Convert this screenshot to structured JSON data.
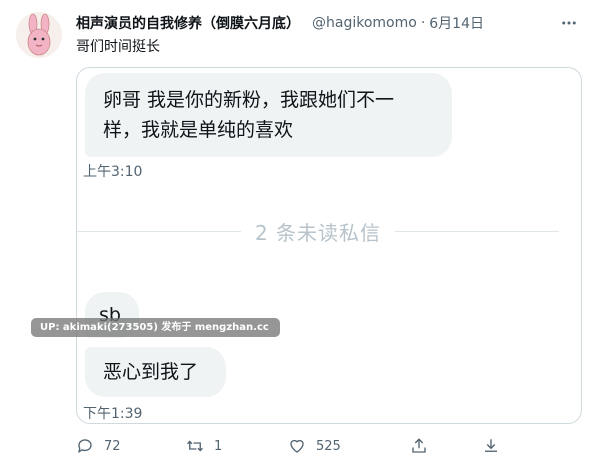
{
  "tweet": {
    "author_name": "相声演员的自我修养（倒膜六月底）",
    "handle": "@hagikomomo",
    "separator": "·",
    "date": "6月14日",
    "text": "哥们时间挺长"
  },
  "media": {
    "messages": [
      {
        "text_line1": "卵哥 我是你的新粉，我跟她们不一",
        "text_line2": "样，我就是单纯的喜欢"
      },
      {
        "text": "sb"
      },
      {
        "text": "恶心到我了"
      }
    ],
    "timestamps": [
      "上午3:10",
      "下午1:39"
    ],
    "unread_divider": "2 条未读私信",
    "watermark": "UP: akimaki(273505) 发布于 mengzhan.cc"
  },
  "actions": {
    "reply_count": "72",
    "retweet_count": "1",
    "like_count": "525"
  },
  "icons": [
    "avatar-bunny",
    "more-icon",
    "reply-icon",
    "retweet-icon",
    "like-icon",
    "share-icon",
    "download-icon"
  ],
  "colors": {
    "bubble": "#eff3f4",
    "secondary_text": "#536471",
    "border": "#cfd9de"
  }
}
